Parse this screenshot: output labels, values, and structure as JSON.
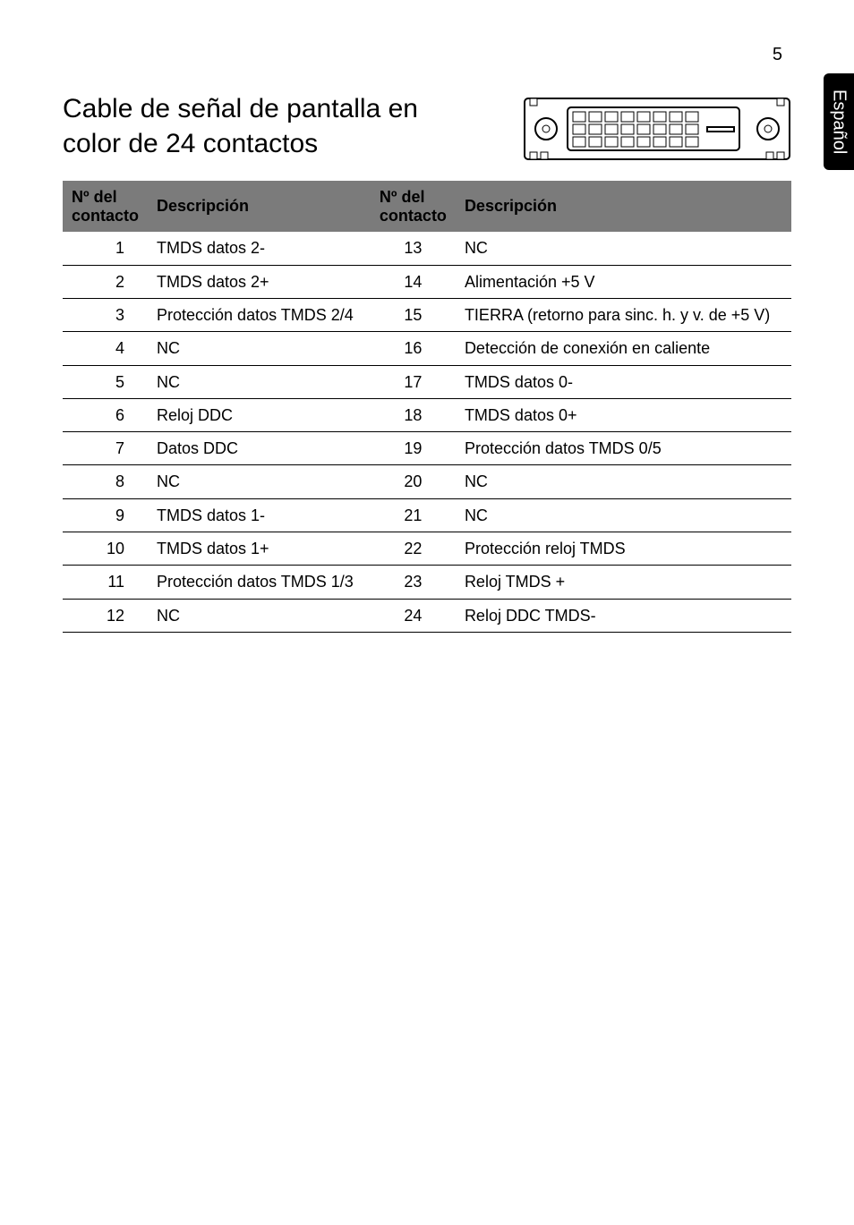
{
  "page_number": "5",
  "side_tab": "Español",
  "title": "Cable de señal de pantalla en color de 24 contactos",
  "table": {
    "headers": {
      "pin1": "Nº del\ncontacto",
      "desc1": "Descripción",
      "pin2": "Nº del\ncontacto",
      "desc2": "Descripción"
    },
    "rows": [
      {
        "p1": "1",
        "d1": "TMDS datos 2-",
        "p2": "13",
        "d2": "NC"
      },
      {
        "p1": "2",
        "d1": "TMDS datos 2+",
        "p2": "14",
        "d2": "Alimentación +5 V"
      },
      {
        "p1": "3",
        "d1": "Protección datos TMDS 2/4",
        "p2": "15",
        "d2": "TIERRA (retorno para sinc. h. y v. de +5 V)"
      },
      {
        "p1": "4",
        "d1": "NC",
        "p2": "16",
        "d2": "Detección de conexión en caliente"
      },
      {
        "p1": "5",
        "d1": "NC",
        "p2": "17",
        "d2": "TMDS datos 0-"
      },
      {
        "p1": "6",
        "d1": "Reloj DDC",
        "p2": "18",
        "d2": "TMDS datos 0+"
      },
      {
        "p1": "7",
        "d1": "Datos DDC",
        "p2": "19",
        "d2": "Protección datos TMDS 0/5"
      },
      {
        "p1": "8",
        "d1": "NC",
        "p2": "20",
        "d2": "NC"
      },
      {
        "p1": "9",
        "d1": "TMDS datos 1-",
        "p2": "21",
        "d2": "NC"
      },
      {
        "p1": "10",
        "d1": "TMDS datos 1+",
        "p2": "22",
        "d2": "Protección reloj TMDS"
      },
      {
        "p1": "11",
        "d1": "Protección datos TMDS 1/3",
        "p2": "23",
        "d2": "Reloj TMDS +"
      },
      {
        "p1": "12",
        "d1": "NC",
        "p2": "24",
        "d2": "Reloj DDC TMDS-"
      }
    ]
  }
}
